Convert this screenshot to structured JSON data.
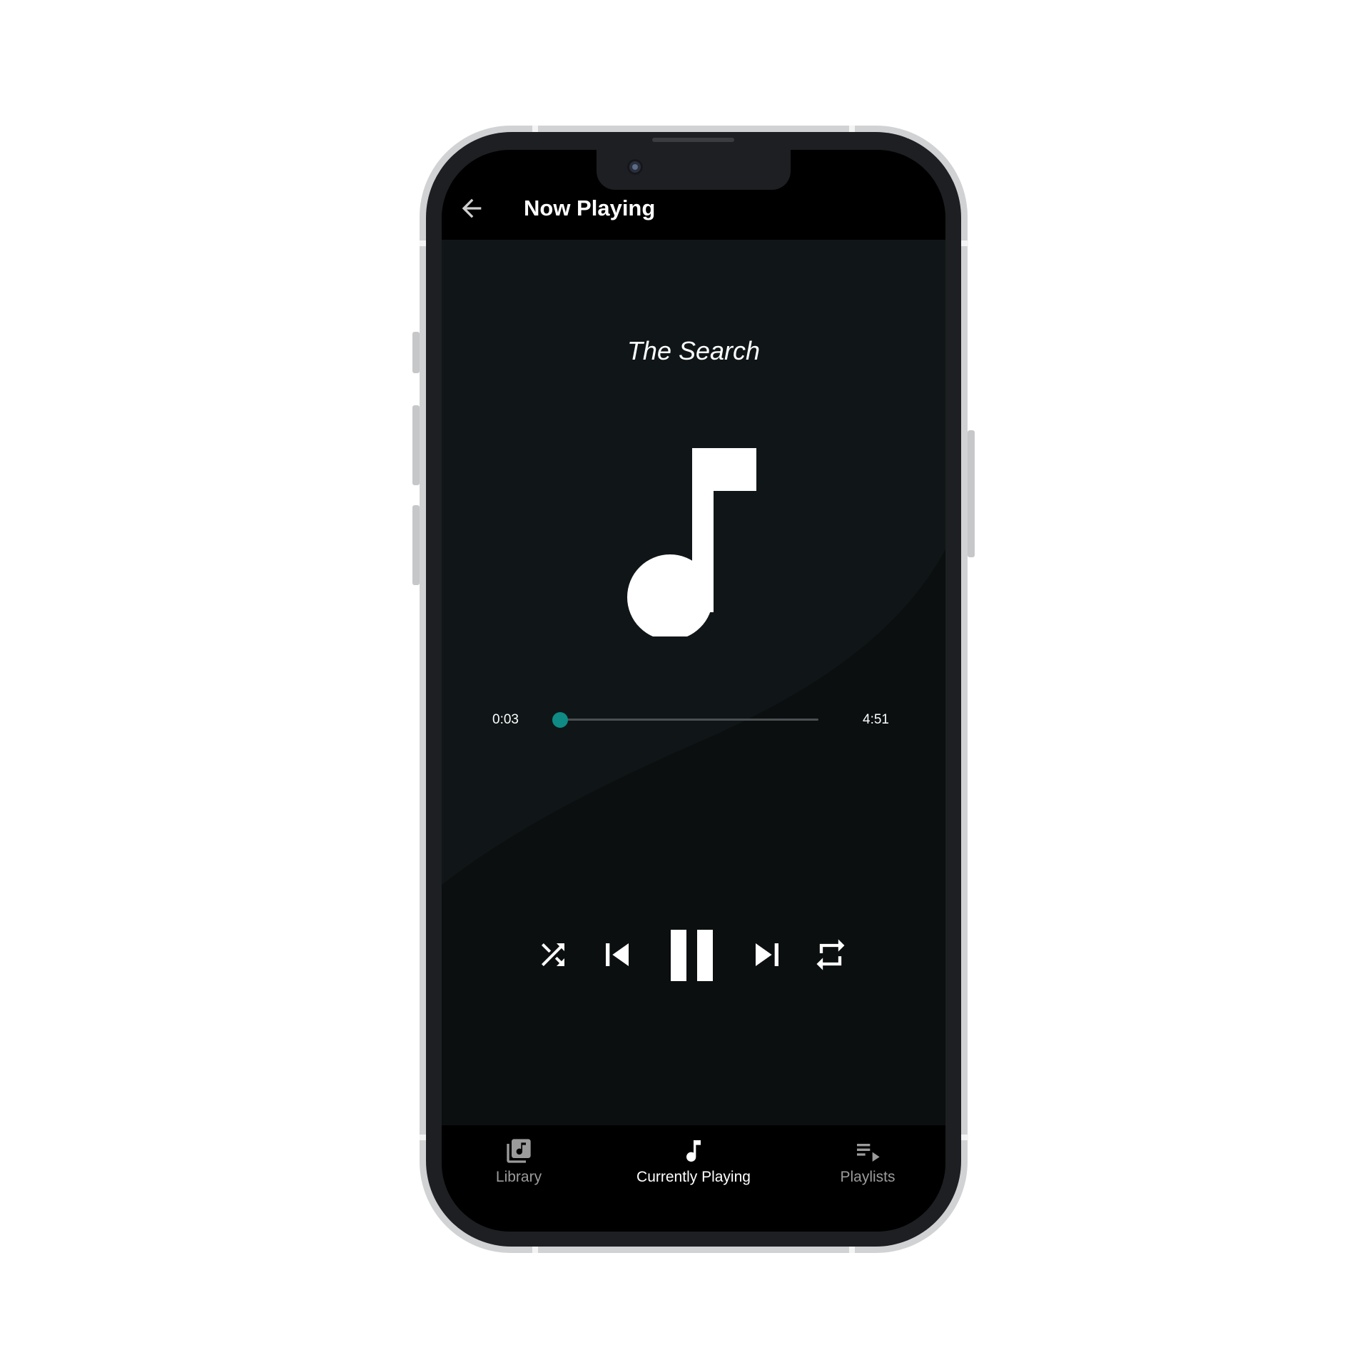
{
  "app_bar": {
    "back_icon": "arrow-back-icon",
    "title": "Now Playing"
  },
  "track": {
    "title": "The Search",
    "artwork_icon": "music-note-icon"
  },
  "playback": {
    "elapsed": "0:03",
    "duration": "4:51",
    "progress_fraction": 0.0103,
    "controls": [
      "shuffle-icon",
      "skip-previous-icon",
      "pause-icon",
      "skip-next-icon",
      "repeat-icon"
    ]
  },
  "bottom_nav": {
    "items": [
      {
        "label": "Library",
        "icon": "library-music-icon",
        "active": false
      },
      {
        "label": "Currently Playing",
        "icon": "music-note-icon",
        "active": true
      },
      {
        "label": "Playlists",
        "icon": "playlist-play-icon",
        "active": false
      }
    ]
  },
  "colors": {
    "accent": "#0f8a84",
    "background": "#0b0f10",
    "bar_background": "#000000",
    "text_primary": "#ffffff",
    "text_inactive": "#9b9b9b"
  }
}
